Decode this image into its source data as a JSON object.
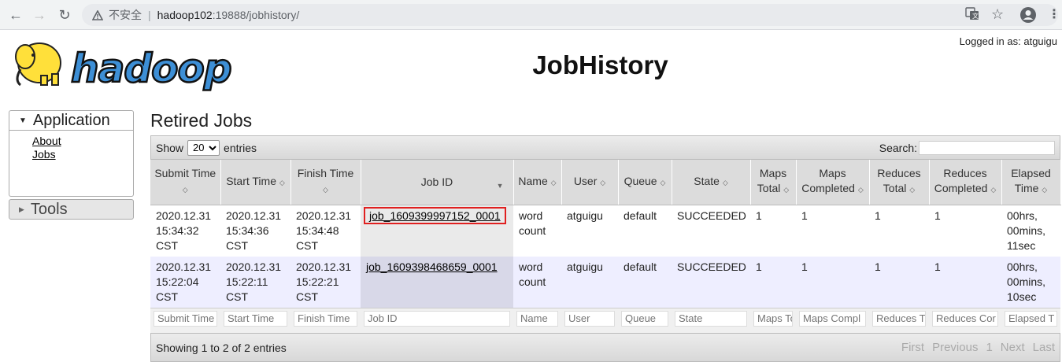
{
  "browser": {
    "insecure_label": "不安全",
    "url_host": "hadoop102",
    "url_path": ":19888/jobhistory/"
  },
  "header": {
    "logo_text": "hadoop",
    "title": "JobHistory",
    "logged_in": "Logged in as: atguigu"
  },
  "sidebar": {
    "application_label": "Application",
    "links": [
      "About",
      "Jobs"
    ],
    "tools_label": "Tools"
  },
  "main": {
    "section_title": "Retired Jobs",
    "show_label": "Show",
    "entries_label": "entries",
    "page_size": "20",
    "search_label": "Search:",
    "columns": [
      "Submit Time",
      "Start Time",
      "Finish Time",
      "Job ID",
      "Name",
      "User",
      "Queue",
      "State",
      "Maps Total",
      "Maps Completed",
      "Reduces Total",
      "Reduces Completed",
      "Elapsed Time"
    ],
    "rows": [
      {
        "submit": "2020.12.31 15:34:32 CST",
        "start": "2020.12.31 15:34:36 CST",
        "finish": "2020.12.31 15:34:48 CST",
        "job_id": "job_1609399997152_0001",
        "name": "word count",
        "user": "atguigu",
        "queue": "default",
        "state": "SUCCEEDED",
        "maps_total": "1",
        "maps_completed": "1",
        "reduces_total": "1",
        "reduces_completed": "1",
        "elapsed": "00hrs, 00mins, 11sec"
      },
      {
        "submit": "2020.12.31 15:22:04 CST",
        "start": "2020.12.31 15:22:11 CST",
        "finish": "2020.12.31 15:22:21 CST",
        "job_id": "job_1609398468659_0001",
        "name": "word count",
        "user": "atguigu",
        "queue": "default",
        "state": "SUCCEEDED",
        "maps_total": "1",
        "maps_completed": "1",
        "reduces_total": "1",
        "reduces_completed": "1",
        "elapsed": "00hrs, 00mins, 10sec"
      }
    ],
    "filters": [
      "Submit Time",
      "Start Time",
      "Finish Time",
      "Job ID",
      "Name",
      "User",
      "Queue",
      "State",
      "Maps To",
      "Maps Compl",
      "Reduces T",
      "Reduces Cor",
      "Elapsed T"
    ],
    "info": "Showing 1 to 2 of 2 entries",
    "pager": [
      "First",
      "Previous",
      "1",
      "Next",
      "Last"
    ]
  },
  "colors": {
    "highlight_box": "#e02020",
    "even_row": "#eeeeff",
    "logo_blue": "#3d8fd6",
    "elephant_yellow": "#ffe03a"
  }
}
